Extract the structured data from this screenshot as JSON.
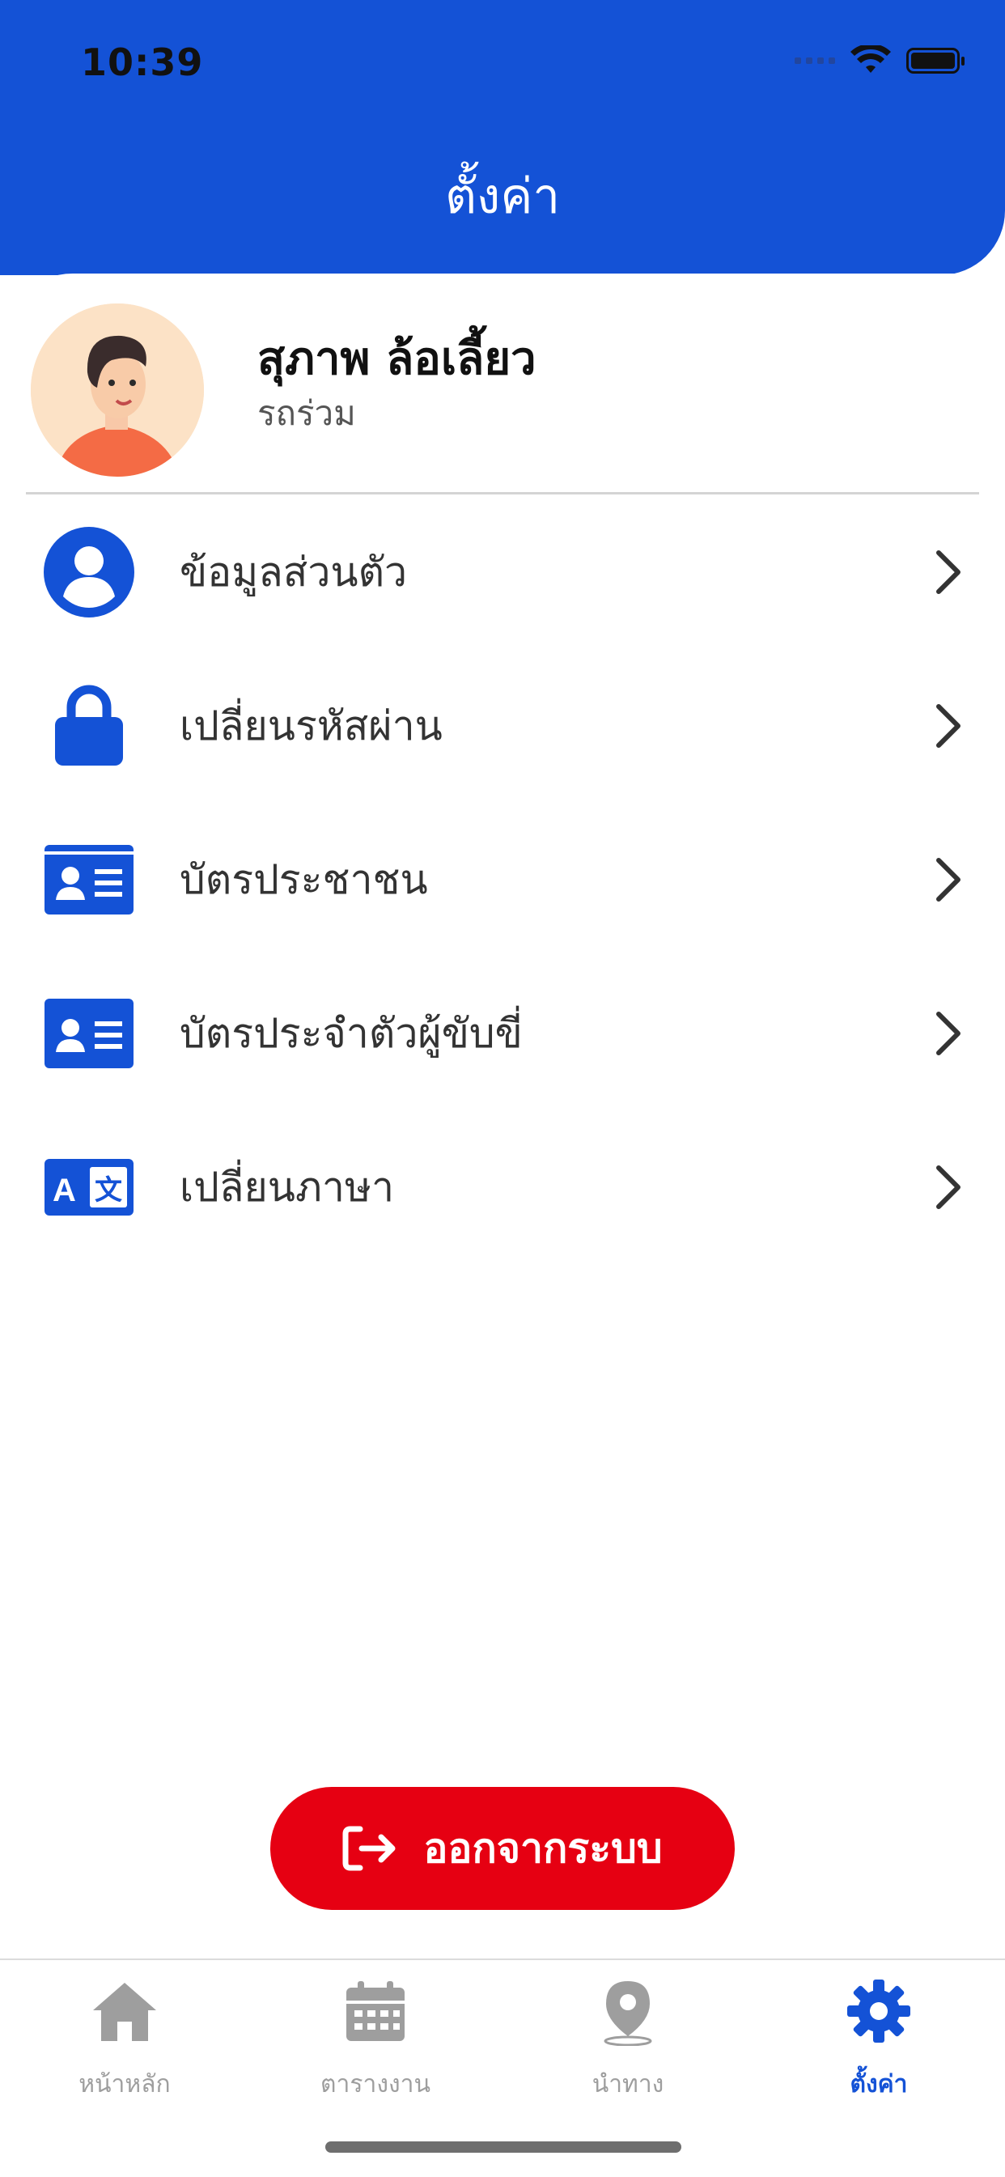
{
  "status_bar": {
    "time": "10:39"
  },
  "header": {
    "title": "ตั้งค่า"
  },
  "profile": {
    "name": "สุภาพ ล้อเลี้ยว",
    "role": "รถร่วม"
  },
  "menu": [
    {
      "label": "ข้อมูลส่วนตัว",
      "icon": "user-circle-icon"
    },
    {
      "label": "เปลี่ยนรหัสผ่าน",
      "icon": "lock-icon"
    },
    {
      "label": "บัตรประชาชน",
      "icon": "id-card-icon"
    },
    {
      "label": "บัตรประจำตัวผู้ขับขี่",
      "icon": "id-card-icon"
    },
    {
      "label": "เปลี่ยนภาษา",
      "icon": "translate-icon"
    }
  ],
  "logout": {
    "label": "ออกจากระบบ",
    "icon": "logout-icon"
  },
  "tabbar": {
    "tabs": [
      {
        "label": "หน้าหลัก",
        "icon": "home-icon",
        "active": false
      },
      {
        "label": "ตารางงาน",
        "icon": "calendar-icon",
        "active": false
      },
      {
        "label": "นำทาง",
        "icon": "map-pin-icon",
        "active": false
      },
      {
        "label": "ตั้งค่า",
        "icon": "gear-icon",
        "active": true
      }
    ]
  },
  "colors": {
    "primary": "#1452D6",
    "danger": "#E60012",
    "inactive": "#9E9E9E"
  }
}
